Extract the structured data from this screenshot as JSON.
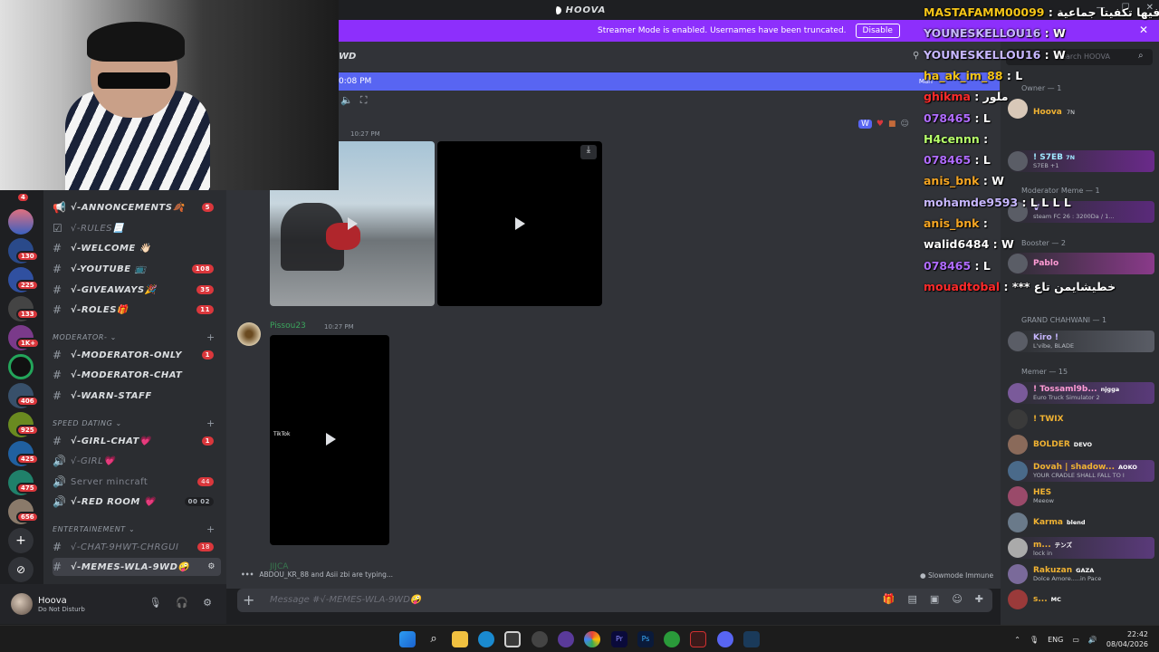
{
  "window": {
    "title": "HOOVA"
  },
  "banner": {
    "text": "Streamer Mode is enabled. Usernames have been truncated.",
    "disable_label": "Disable"
  },
  "header": {
    "channel_fragment": "WD",
    "search_placeholder": "Search HOOVA"
  },
  "voice": {
    "time": "0:08 PM",
    "right_text": "Mari"
  },
  "overlay_chat": [
    {
      "user": "MASTAFAMM00099",
      "msg": "فيها تكفيتا جماعية",
      "color": "#f5c518"
    },
    {
      "user": "YOUNESKELLOU16",
      "msg": "W",
      "color": "#c7b7ff"
    },
    {
      "user": "YOUNESKELLOU16",
      "msg": "W",
      "color": "#c7b7ff"
    },
    {
      "user": "ha_ak_im_88",
      "msg": "L",
      "color": "#f5c518"
    },
    {
      "user": "ghikma",
      "msg": "ملور",
      "color": "#ff2b2b"
    },
    {
      "user": "078465",
      "msg": "L",
      "color": "#b06cff"
    },
    {
      "user": "H4cennn",
      "msg": "",
      "color": "#b6ff6a"
    },
    {
      "user": "078465",
      "msg": "L",
      "color": "#b06cff"
    },
    {
      "user": "anis_bnk",
      "msg": "W",
      "color": "#f5a623"
    },
    {
      "user": "mohamde9593",
      "msg": "L L L L",
      "color": "#c7b7ff"
    },
    {
      "user": "anis_bnk",
      "msg": "",
      "color": "#f5a623"
    },
    {
      "user": "walid6484",
      "msg": "W",
      "color": "#ffffff"
    },
    {
      "user": "078465",
      "msg": "L",
      "color": "#b06cff"
    },
    {
      "user": "mouadtobal",
      "msg": "*** خطيشايمن تاع",
      "color": "#ff2b2b"
    }
  ],
  "channels": {
    "items": [
      {
        "name": "√-ANNONCEMENTS🍂",
        "icon": "#",
        "badge": "5"
      },
      {
        "name": "√-RULES📃",
        "icon": "☑",
        "badge": "",
        "muted": true
      },
      {
        "name": "√-WELCOME 👋🏻",
        "icon": "#",
        "badge": ""
      },
      {
        "name": "√-YOUTUBE 📺",
        "icon": "#",
        "badge": "108"
      },
      {
        "name": "√-GIVEAWAYS🎉",
        "icon": "#",
        "badge": "35"
      },
      {
        "name": "√-ROLES🎁",
        "icon": "#",
        "badge": "11"
      }
    ],
    "cat_moderator": "MODERATOR-",
    "moderator": [
      {
        "name": "√-MODERATOR-ONLY",
        "badge": "1"
      },
      {
        "name": "√-MODERATOR-CHAT",
        "badge": ""
      },
      {
        "name": "√-WARN-STAFF",
        "badge": ""
      }
    ],
    "cat_speed": "SPEED DATING",
    "speed": [
      {
        "name": "√-GIRL-CHAT💗",
        "icon": "#",
        "badge": "1"
      },
      {
        "name": "√-GIRL💗",
        "icon": "🔊",
        "badge": "",
        "muted": true
      },
      {
        "name": "Server mincraft",
        "icon": "🔊",
        "badge": "44",
        "muted": true
      },
      {
        "name": "√-RED ROOM 💗",
        "icon": "🔊",
        "badge": "00 02"
      }
    ],
    "cat_ent": "ENTERTAINEMENT",
    "ent": [
      {
        "name": "√-CHAT-9HWT-CHRGUI",
        "icon": "#",
        "badge": "18",
        "muted": true
      },
      {
        "name": "√-MEMES-WLA-9WD🤪",
        "icon": "#",
        "badge": ""
      }
    ]
  },
  "guild_badges": [
    "4",
    "130",
    "225",
    "133",
    "1K+",
    "406",
    "925",
    "425",
    "475",
    "656"
  ],
  "user": {
    "name": "Hoova",
    "status": "Do Not Disturb"
  },
  "messages": {
    "first_time": "10:27 PM",
    "second_author": "Pissou23",
    "second_time": "10:27 PM",
    "third_author": "JIJCA",
    "tiktok_label": "TikTok"
  },
  "typing": {
    "text": "ABDOU_KR_88 and Asii zbi are typing...",
    "slowmode": "Slowmode Immune"
  },
  "composer": {
    "placeholder": "Message #√-MEMES-WLA-9WD🤪"
  },
  "members": {
    "owner_header": "Owner — 1",
    "owner": {
      "name": "Hoova",
      "tag": "7N",
      "color": "#f0b232"
    },
    "s7eb": {
      "name": "! S7EB",
      "tag": "7N",
      "sub": "S7EB +1",
      "color": "#a0e8ff"
    },
    "modmeme_header": "Moderator Meme — 1",
    "modmeme": {
      "name": "V",
      "sub": "steam FC 26 : 3200Da / 1...",
      "color": "#c7b7ff"
    },
    "booster_header": "Booster — 2",
    "pablo": {
      "name": "Pablo",
      "color": "#ff9bd5"
    },
    "grand_header": "GRAND CHAHWANI — 1",
    "kiro": {
      "name": "Kiro !",
      "sub": "L'vibe, BLADE",
      "color": "#c7b7ff"
    },
    "memer_header": "Memer — 15",
    "memers": [
      {
        "name": "! Tossaml9b...",
        "tag": "njgga",
        "sub": "Euro Truck Simulator 2",
        "color": "#ff9bd5"
      },
      {
        "name": "! TWIX",
        "tag": "",
        "sub": "",
        "color": "#f0b232"
      },
      {
        "name": "BOLDER",
        "tag": "DEVO",
        "sub": "",
        "color": "#f0b232"
      },
      {
        "name": "Dovah | shadow...",
        "tag": "AOKO",
        "sub": "YOUR CRADLE SHALL FALL TO I",
        "color": "#f0b232"
      },
      {
        "name": "HES",
        "tag": "",
        "sub": "Meeow",
        "color": "#f0b232"
      },
      {
        "name": "Karma",
        "tag": "blend",
        "sub": "",
        "color": "#f0b232"
      },
      {
        "name": "m...",
        "tag": "テンズ",
        "sub": "lock in",
        "color": "#f0b232"
      },
      {
        "name": "Rakuzan",
        "tag": "GAZA",
        "sub": "Dolce Amore.....in Pace",
        "color": "#f0b232"
      },
      {
        "name": "s...",
        "tag": "MC",
        "sub": "",
        "color": "#f0b232"
      }
    ]
  },
  "tray": {
    "lang": "ENG",
    "time": "22:42",
    "date": "08/04/2026"
  }
}
